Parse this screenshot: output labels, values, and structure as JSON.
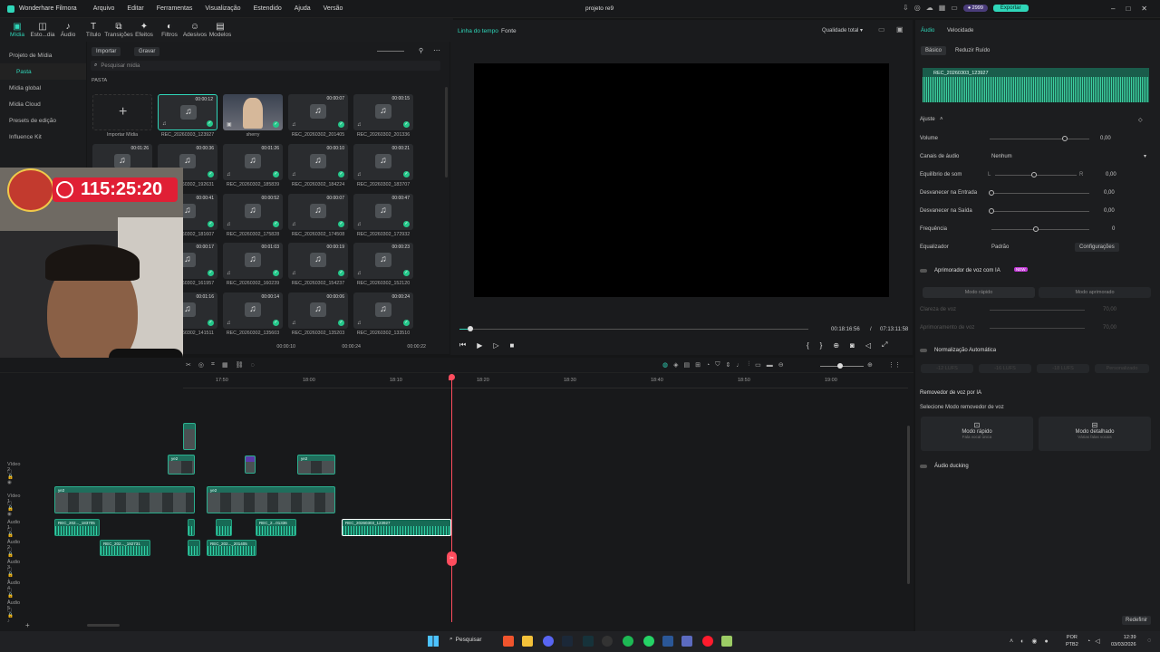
{
  "titlebar": {
    "app": "Wonderhare Filmora",
    "menu": [
      "Arquivo",
      "Editar",
      "Ferramentas",
      "Visualização",
      "Estendido",
      "Ajuda",
      "Versão"
    ],
    "project": "projeto re9",
    "credits": "2999",
    "export": "Exportar"
  },
  "toolbar": {
    "items": [
      "Mídia",
      "Esto...dia",
      "Áudio",
      "Título",
      "Transições",
      "Efeitos",
      "Filtros",
      "Adesivos",
      "Modelos"
    ]
  },
  "leftnav": {
    "items": [
      "Projeto de Mídia",
      "Pasta",
      "Mídia global",
      "Mídia Cloud",
      "Presets de edição",
      "Influence Kit"
    ]
  },
  "media": {
    "import_label": "Importar",
    "record_label": "Gravar",
    "search_placeholder": "Pesquisar mídia",
    "folder": "PASTA",
    "import_media": "Importar Mídia",
    "row1": [
      {
        "name": "REC_20260303_123927",
        "dur": "00:00:12"
      },
      {
        "name": "sherry",
        "dur": ""
      },
      {
        "name": "REC_20260302_201405",
        "dur": "00:00:07"
      },
      {
        "name": "REC_20260302_201336",
        "dur": "00:00:15"
      }
    ],
    "row2": [
      {
        "name": "",
        "dur": "00:01:26"
      },
      {
        "name": "REC_20260302_192631",
        "dur": "00:00:36"
      },
      {
        "name": "REC_20260302_185839",
        "dur": "00:01:26"
      },
      {
        "name": "REC_20260302_184224",
        "dur": "00:00:10"
      },
      {
        "name": "REC_20260302_183707",
        "dur": "00:00:21"
      }
    ],
    "row3": [
      {
        "name": "REC_20260302_181607",
        "dur": "00:00:41"
      },
      {
        "name": "REC_20260302_175828",
        "dur": "00:00:52"
      },
      {
        "name": "REC_20260302_174508",
        "dur": "00:00:07"
      },
      {
        "name": "REC_20260302_172932",
        "dur": "00:00:47"
      }
    ],
    "row4": [
      {
        "name": "REC_20260302_161957",
        "dur": "00:00:17"
      },
      {
        "name": "REC_20260302_160239",
        "dur": "00:01:03"
      },
      {
        "name": "REC_20260302_154237",
        "dur": "00:00:19"
      },
      {
        "name": "REC_20260302_152120",
        "dur": "00:00:23"
      }
    ],
    "row5": [
      {
        "name": "REC_20260302_141511",
        "dur": "00:01:16"
      },
      {
        "name": "REC_20260302_135603",
        "dur": "00:00:14"
      },
      {
        "name": "REC_20260302_135203",
        "dur": "00:00:06"
      },
      {
        "name": "REC_20260302_133510",
        "dur": "00:00:24"
      }
    ],
    "row6": [
      {
        "dur": "00:00:10"
      },
      {
        "dur": "00:00:24"
      },
      {
        "dur": "00:00:22"
      }
    ]
  },
  "preview": {
    "tab_timeline": "Linha do tempo",
    "tab_source": "Fonte",
    "quality": "Qualidade total",
    "current": "00:18:16:56",
    "separator": "/",
    "total": "07:13:11:58",
    "progress": 0.03
  },
  "overlay": {
    "timer": "115:25:20"
  },
  "right": {
    "tab_audio": "Áudio",
    "tab_speed": "Velocidade",
    "sub_basic": "Básico",
    "sub_noise": "Reduzir Ruído",
    "clip_name": "REC_20260303_123927",
    "ajuste": "Ajuste",
    "volume": {
      "label": "Volume",
      "value": "0,00"
    },
    "channels": {
      "label": "Canais de áudio",
      "value": "Nenhum"
    },
    "balance": {
      "label": "Equilíbrio de som",
      "l": "L",
      "r": "R",
      "value": "0,00"
    },
    "fadein": {
      "label": "Desvanecer na Entrada",
      "value": "0,00"
    },
    "fadeout": {
      "label": "Desvanecer na Saída",
      "value": "0,00"
    },
    "freq": {
      "label": "Frequência",
      "value": "0"
    },
    "eq": {
      "label": "Equalizador",
      "value": "Padrão",
      "config": "Configurações"
    },
    "enhancer": {
      "label": "Aprimorador de voz com IA",
      "badge": "NEW",
      "mode1": "Modo rápido",
      "mode2": "Modo aprimorado",
      "clarity": "Clareza de voz",
      "clarity_val": "70,00",
      "enhance": "Aprimoramento de voz",
      "enhance_val": "70,00"
    },
    "normalize": {
      "label": "Normalização Automática",
      "opts": [
        "-12 LUFS",
        "-16 LUFS",
        "-18 LUFS",
        "Personalizado"
      ]
    },
    "remover": {
      "label": "Removedor de voz por IA",
      "select": "Selecione Modo removedor de voz",
      "fast": "Modo rápido",
      "fast_sub": "Fala vocal única",
      "detail": "Modo detalhado",
      "detail_sub": "Várias falas vocais"
    },
    "ducking": {
      "label": "Áudio ducking"
    },
    "reset": "Redefinir"
  },
  "timeline": {
    "ruler": [
      "17:50",
      "18:00",
      "18:10",
      "18:20",
      "18:30",
      "18:40",
      "18:50",
      "19:00"
    ],
    "tracks": [
      "Vídeo 2",
      "Vídeo 1",
      "Áudio 1",
      "Áudio 2",
      "Áudio 3",
      "Áudio 4",
      "Áudio 5"
    ],
    "clips": {
      "a1a": "REC_202..._183705",
      "a1b": "REC_2...01336",
      "a1c": "REC_20260303_123927",
      "a2a": "REC_202..._192731",
      "a2b": "REC_202..._201405",
      "v": "ye2"
    }
  },
  "taskbar": {
    "search": "Pesquisar",
    "lang1": "POR",
    "lang2": "PTB2",
    "time": "12:39",
    "date": "03/03/2026"
  }
}
